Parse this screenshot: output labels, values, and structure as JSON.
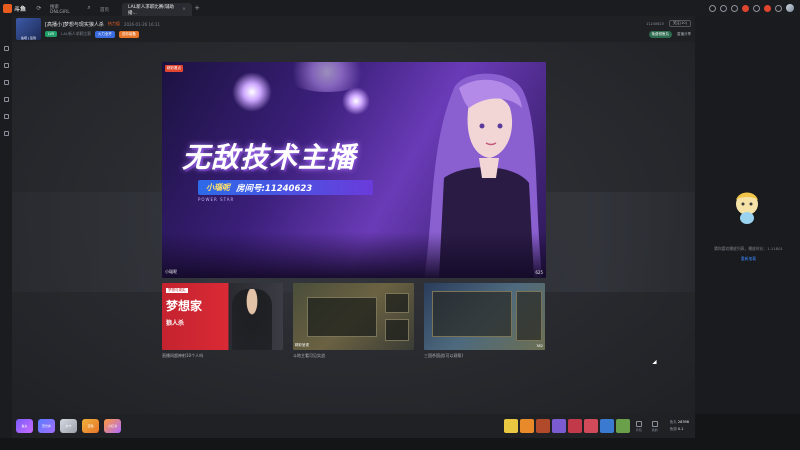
{
  "app": {
    "logo_text": "斗鱼"
  },
  "tabs": [
    {
      "label": "搜索DNLGIRL"
    },
    {
      "label": "首页"
    },
    {
      "label": "LAL新人求职比赛(辅助播..."
    }
  ],
  "header": {
    "title": "[高播小]梦想与现实狼人杀",
    "hot": "热力值",
    "time": "2026-01-26 16:11",
    "avatar_label": "鱼吧 | 签到",
    "tag1": "LV5",
    "tag_text": "LAL新人求职比赛",
    "tag2": "火力全开",
    "tag3": "送你装备",
    "room_id": "11240623",
    "follow": "关注(10)",
    "pill": "免费领鱼丸",
    "link": "直播分享"
  },
  "hero": {
    "badge": "精彩看点",
    "headline": "无敌技术主播",
    "bar_name": "小瑙呢",
    "bar_room": "房间号:11240623",
    "sub": "POWER STAR",
    "foot_left": "小瑙呢",
    "foot_right": "625"
  },
  "thumbs": [
    {
      "caption": "直播间超神射10个人吗",
      "title": "梦想家",
      "sub": "狼人杀",
      "top": "梦想与现实"
    },
    {
      "caption": "斗地主看可见实战",
      "live": "精彩呈现"
    },
    {
      "caption": "三国杀国战(可以观帮)",
      "live": "382"
    }
  ],
  "right_panel": {
    "text": "猜你喜欢播放列表，播放时长：1.11801",
    "link": "重新加载"
  },
  "bottom": {
    "gifts_left": [
      "鱼丸",
      "荧光棒",
      "办卡",
      "宝箱",
      "小红书"
    ],
    "ctrl1": "背包",
    "ctrl2": "我的",
    "stat1_label": "鱼丸",
    "stat1_value": "28398",
    "stat2_label": "鱼翅",
    "stat2_value": "0.1"
  },
  "colors": {
    "accent": "#e85d1f",
    "brand_blue": "#3a6be0",
    "link": "#3a8bff"
  }
}
